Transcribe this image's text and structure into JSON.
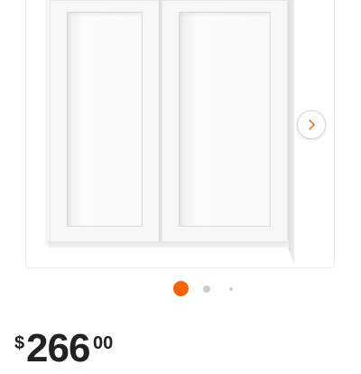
{
  "gallery": {
    "image_name": "white-shaker-wall-cabinet",
    "next_icon": "chevron-right-icon",
    "dots": [
      {
        "state": "active",
        "color": "#f96302"
      },
      {
        "state": "inactive",
        "color": "#cccccc"
      },
      {
        "state": "inactive",
        "color": "#cccccc"
      }
    ]
  },
  "price": {
    "currency": "$",
    "whole": "266",
    "cents": "00"
  },
  "colors": {
    "accent": "#f96302",
    "text": "#222222"
  }
}
